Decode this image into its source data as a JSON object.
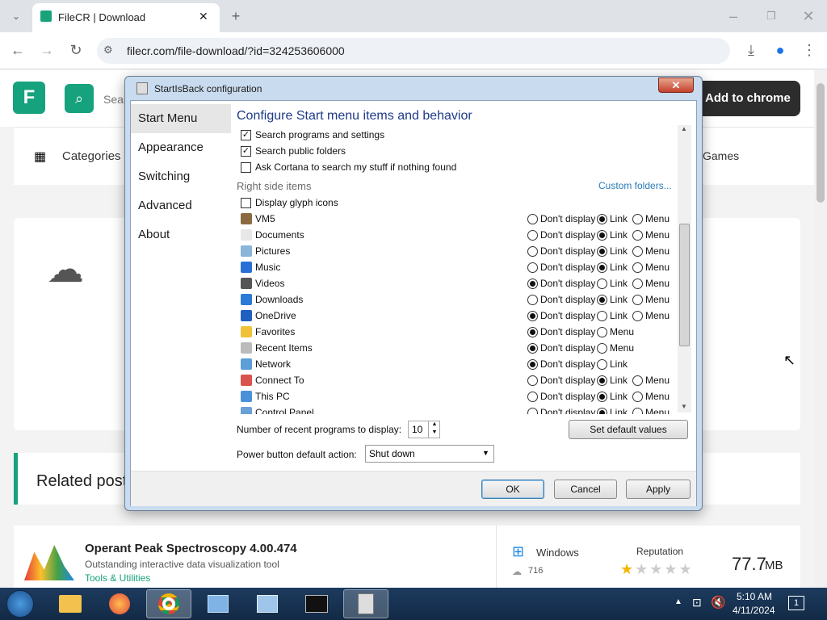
{
  "browser": {
    "tab_title": "FileCR | Download",
    "url": "filecr.com/file-download/?id=324253606000"
  },
  "site": {
    "search_placeholder": "Sear",
    "add_to_chrome": "Add to chrome",
    "categories": "Categories",
    "games": "Games",
    "related_posts": "Related post",
    "product": {
      "name": "Operant Peak Spectroscopy 4.00.474",
      "description": "Outstanding interactive data visualization tool",
      "category": "Tools & Utilities",
      "os": "Windows",
      "downloads": "716",
      "reputation_label": "Reputation",
      "rating": 1,
      "size": "77.7",
      "size_unit": "MB"
    }
  },
  "dialog": {
    "title": "StartIsBack configuration",
    "close": "✕",
    "sidebar": [
      "Start Menu",
      "Appearance",
      "Switching",
      "Advanced",
      "About"
    ],
    "heading": "Configure Start menu items and behavior",
    "checks": [
      {
        "label": "Search programs and settings",
        "checked": true
      },
      {
        "label": "Search public folders",
        "checked": true
      },
      {
        "label": "Ask Cortana to search my stuff if nothing found",
        "checked": false
      }
    ],
    "right_side_label": "Right side items",
    "custom_folders": "Custom folders...",
    "glyph": {
      "label": "Display glyph icons",
      "checked": false
    },
    "opt_labels": {
      "none": "Don't display",
      "link": "Link",
      "menu": "Menu"
    },
    "items": [
      {
        "label": "VM5",
        "icon": "user-icon",
        "options": [
          "none",
          "link",
          "menu"
        ],
        "selected": "link"
      },
      {
        "label": "Documents",
        "icon": "documents-icon",
        "options": [
          "none",
          "link",
          "menu"
        ],
        "selected": "link"
      },
      {
        "label": "Pictures",
        "icon": "pictures-icon",
        "options": [
          "none",
          "link",
          "menu"
        ],
        "selected": "link"
      },
      {
        "label": "Music",
        "icon": "music-icon",
        "options": [
          "none",
          "link",
          "menu"
        ],
        "selected": "link"
      },
      {
        "label": "Videos",
        "icon": "videos-icon",
        "options": [
          "none",
          "link",
          "menu"
        ],
        "selected": "none"
      },
      {
        "label": "Downloads",
        "icon": "downloads-icon",
        "options": [
          "none",
          "link",
          "menu"
        ],
        "selected": "link"
      },
      {
        "label": "OneDrive",
        "icon": "onedrive-icon",
        "options": [
          "none",
          "link",
          "menu"
        ],
        "selected": "none"
      },
      {
        "label": "Favorites",
        "icon": "star-icon",
        "options": [
          "none",
          "menu"
        ],
        "selected": "none"
      },
      {
        "label": "Recent Items",
        "icon": "recent-icon",
        "options": [
          "none",
          "menu"
        ],
        "selected": "none"
      },
      {
        "label": "Network",
        "icon": "network-icon",
        "options": [
          "none",
          "link"
        ],
        "selected": "none"
      },
      {
        "label": "Connect To",
        "icon": "connect-icon",
        "options": [
          "none",
          "link",
          "menu"
        ],
        "selected": "link"
      },
      {
        "label": "This PC",
        "icon": "pc-icon",
        "options": [
          "none",
          "link",
          "menu"
        ],
        "selected": "link"
      },
      {
        "label": "Control Panel",
        "icon": "control-panel-icon",
        "options": [
          "none",
          "link",
          "menu"
        ],
        "selected": "link"
      }
    ],
    "recent_label": "Number of recent programs to display:",
    "recent_value": "10",
    "set_default": "Set default values",
    "power_label": "Power button default action:",
    "power_value": "Shut down",
    "ok": "OK",
    "cancel": "Cancel",
    "apply": "Apply"
  },
  "taskbar": {
    "time": "5:10 AM",
    "date": "4/11/2024",
    "notifications": "1"
  }
}
